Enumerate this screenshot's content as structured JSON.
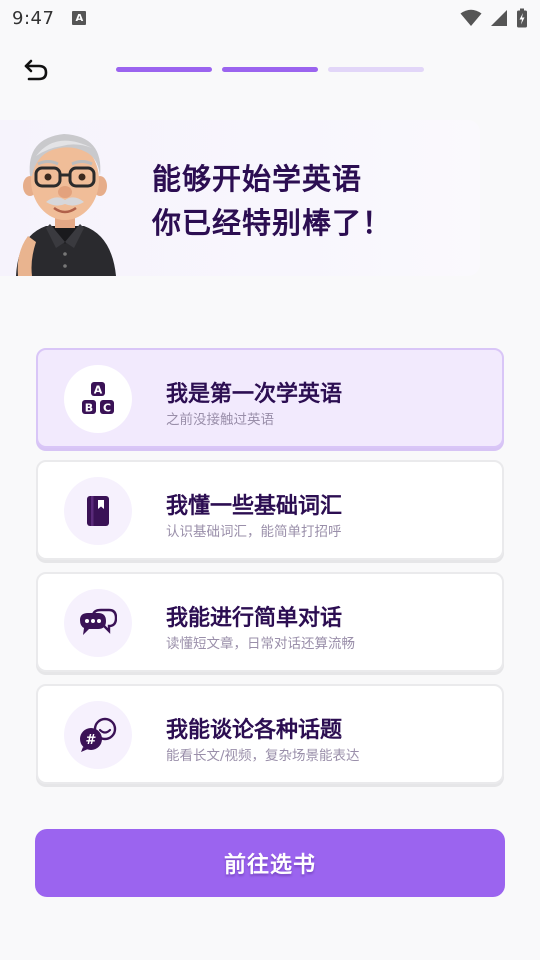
{
  "status_bar": {
    "time": "9:47",
    "notification_letter": "A"
  },
  "progress": {
    "total_steps": 3,
    "completed_steps": 2,
    "active_color": "#9b64ef",
    "inactive_color": "#e2d6f8"
  },
  "hero": {
    "line1": "能够开始学英语",
    "line2": "你已经特别棒了！"
  },
  "options": [
    {
      "title": "我是第一次学英语",
      "subtitle": "之前没接触过英语",
      "icon": "abc-blocks-icon",
      "selected": true
    },
    {
      "title": "我懂一些基础词汇",
      "subtitle": "认识基础词汇，能简单打招呼",
      "icon": "book-icon",
      "selected": false
    },
    {
      "title": "我能进行简单对话",
      "subtitle": "读懂短文章，日常对话还算流畅",
      "icon": "chat-bubbles-icon",
      "selected": false
    },
    {
      "title": "我能谈论各种话题",
      "subtitle": "能看长文/视频，复杂场景能表达",
      "icon": "topic-chat-icon",
      "selected": false
    }
  ],
  "cta": {
    "label": "前往选书"
  },
  "colors": {
    "accent": "#9b64ef",
    "title_text": "#2c0e52",
    "subtitle_text": "#9a8faa",
    "selected_bg": "#f2eafd",
    "icon_dark": "#3a1256"
  }
}
